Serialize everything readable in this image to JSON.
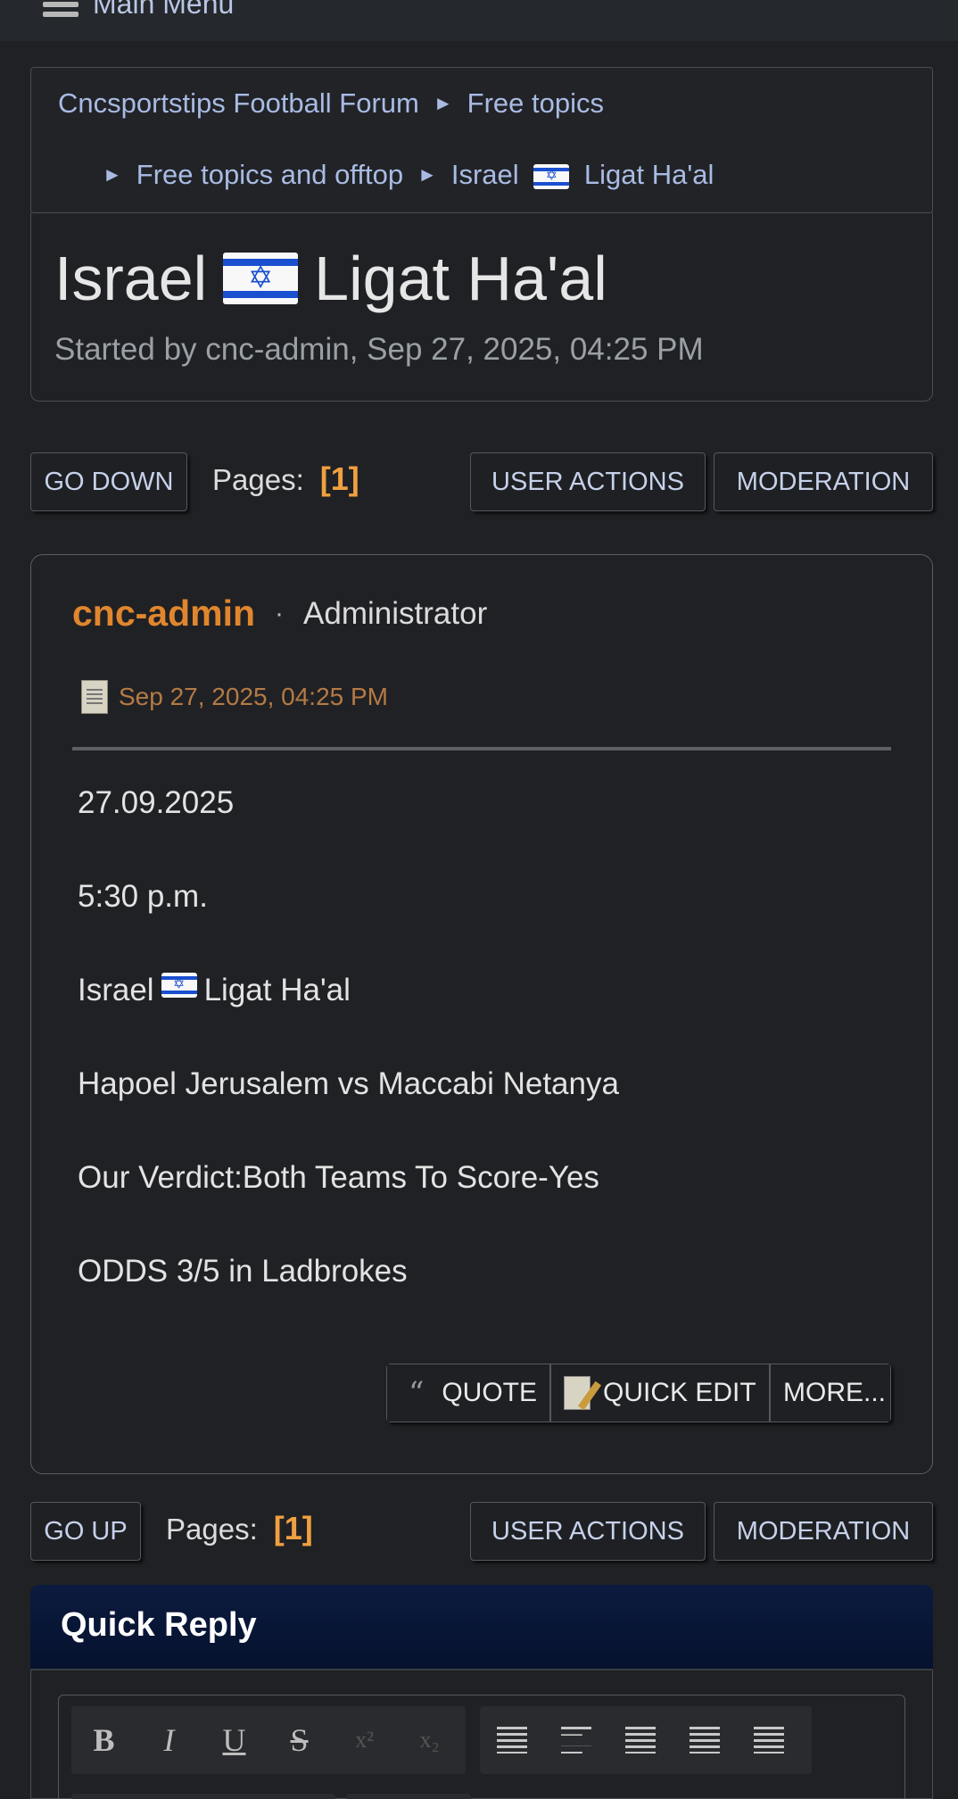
{
  "menu": {
    "label": "Main Menu"
  },
  "breadcrumb": {
    "items": [
      "Cncsportstips Football Forum",
      "Free topics",
      "Free topics and offtop",
      "Israel",
      "Ligat Ha'al"
    ],
    "separator": "►"
  },
  "topic": {
    "title_prefix": "Israel",
    "title_suffix": "Ligat Ha'al",
    "started_by": "Started by cnc-admin, Sep 27, 2025, 04:25 PM"
  },
  "nav_top": {
    "go_down": "GO DOWN",
    "pages_label": "Pages:",
    "page_num": "[1]",
    "user_actions": "USER ACTIONS",
    "moderation": "MODERATION"
  },
  "post": {
    "author": "cnc-admin",
    "separator": "·",
    "role": "Administrator",
    "date": "Sep 27, 2025, 04:25 PM",
    "lines": {
      "date": "27.09.2025",
      "time": "5:30 p.m.",
      "league_prefix": "Israel",
      "league_suffix": "Ligat Ha'al",
      "match": "Hapoel Jerusalem vs Maccabi Netanya",
      "verdict": "Our Verdict:Both Teams To Score-Yes",
      "odds": "ODDS 3/5 in Ladbrokes"
    },
    "actions": {
      "quote": "QUOTE",
      "quick_edit": "QUICK EDIT",
      "more": "MORE..."
    }
  },
  "nav_bottom": {
    "go_up": "GO UP",
    "pages_label": "Pages:",
    "page_num": "[1]",
    "user_actions": "USER ACTIONS",
    "moderation": "MODERATION"
  },
  "quick_reply": {
    "title": "Quick Reply",
    "toolbar": {
      "bold": "B",
      "italic": "I",
      "underline": "U",
      "strike": "S",
      "superscript": "x²",
      "subscript": "x₂"
    }
  },
  "colors": {
    "accent": "#e0862e",
    "link": "#a9bbe3",
    "page_num": "#f0a040",
    "header_bg": "#0b1a3e"
  }
}
